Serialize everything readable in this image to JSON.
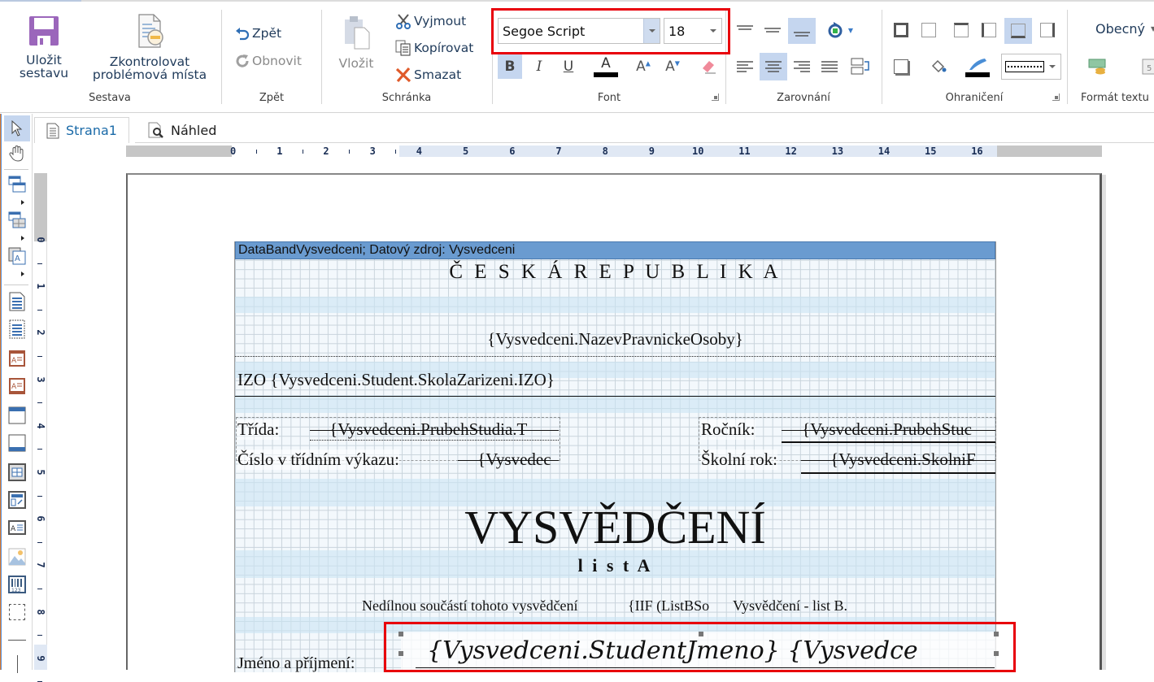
{
  "ribbon": {
    "groups": {
      "sestava": {
        "label": "Sestava",
        "save_line1": "Uložit",
        "save_line2": "sestavu",
        "check_line1": "Zkontrolovat",
        "check_line2": "problémová místa"
      },
      "zpet": {
        "label": "Zpět",
        "undo": "Zpět",
        "redo": "Obnovit"
      },
      "schranka": {
        "label": "Schránka",
        "paste": "Vložit",
        "cut": "Vyjmout",
        "copy": "Kopírovat",
        "delete": "Smazat"
      },
      "font": {
        "label": "Font",
        "font_name": "Segoe Script",
        "font_size": "18",
        "bold_active": true,
        "color": "#000000"
      },
      "zarovnani": {
        "label": "Zarovnání",
        "vertical_selected": "bottom",
        "horizontal_selected": "center"
      },
      "ohraniceni": {
        "label": "Ohraničení",
        "border_selected": "bottom",
        "border_color": "#000000",
        "border_style": "dotted"
      },
      "format_textu": {
        "label": "Formát textu",
        "format": "Obecný"
      }
    }
  },
  "tabs": [
    {
      "label": "Strana1",
      "active": true
    },
    {
      "label": "Náhled",
      "active": false
    }
  ],
  "rulers": {
    "horizontal": [
      "0",
      "1",
      "2",
      "3",
      "4",
      "5",
      "6",
      "7",
      "8",
      "9",
      "10",
      "11",
      "12",
      "13",
      "14",
      "15",
      "16"
    ],
    "vertical": [
      "0",
      "1",
      "2",
      "3",
      "4",
      "5",
      "6",
      "7",
      "8",
      "9"
    ]
  },
  "report": {
    "band_header": "DataBandVysvedceni; Datový zdroj: Vysvedceni",
    "country": "Č E S K Á   R E P U B L I K A",
    "school_name": "{Vysvedceni.NazevPravnickeOsoby}",
    "izo": "IZO {Vysvedceni.Student.SkolaZarizeni.IZO}",
    "class_label": "Třída:",
    "class_value": "{Vysvedceni.PrubehStudia.T",
    "register_label": "Číslo v třídním výkazu:",
    "register_value": "{Vysvedec",
    "year_label": "Ročník:",
    "year_value": "{Vysvedceni.PrubehStuc",
    "school_year_label": "Školní rok:",
    "school_year_value": "{Vysvedceni.SkolniF",
    "title": "VYSVĚDČENÍ",
    "subtitle": "l i s t  A",
    "note_part1": "Nedílnou součástí tohoto vysvědčení",
    "note_part2": "{IIF (ListBSo",
    "note_part3": "Vysvědčení - list B.",
    "name_label": "Jméno a příjmení:",
    "name_value": "{Vysvedceni.StudentJmeno} {Vysvedce"
  },
  "colors": {
    "highlight": "#e8000b",
    "active_tab": "#1a6aa8",
    "band_header": "#6a9bd0",
    "selection": "#c5d6ef"
  }
}
